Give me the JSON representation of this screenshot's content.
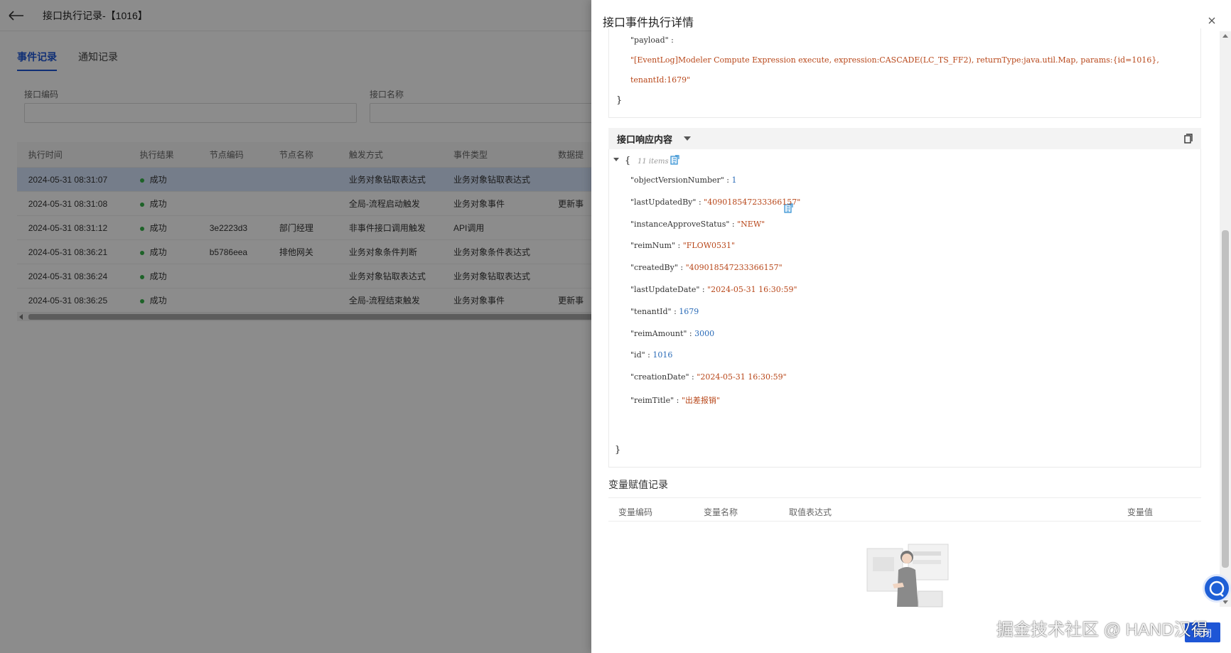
{
  "page": {
    "title": "接口执行记录-【1016】",
    "tabs": [
      {
        "label": "事件记录",
        "active": true
      },
      {
        "label": "通知记录",
        "active": false
      }
    ],
    "filters": {
      "code_label": "接口编码",
      "name_label": "接口名称"
    },
    "table": {
      "headers": [
        "执行时间",
        "执行结果",
        "节点编码",
        "节点名称",
        "触发方式",
        "事件类型",
        "数据提"
      ],
      "rows": [
        {
          "time": "2024-05-31 08:31:07",
          "result": "成功",
          "node_code": "",
          "node_name": "",
          "trigger": "业务对象钻取表达式",
          "event": "业务对象钻取表达式",
          "data": ""
        },
        {
          "time": "2024-05-31 08:31:08",
          "result": "成功",
          "node_code": "",
          "node_name": "",
          "trigger": "全局-流程启动触发",
          "event": "业务对象事件",
          "data": "更新事"
        },
        {
          "time": "2024-05-31 08:31:12",
          "result": "成功",
          "node_code": "3e2223d3",
          "node_name": "部门经理",
          "trigger": "非事件接口调用触发",
          "event": "API调用",
          "data": ""
        },
        {
          "time": "2024-05-31 08:36:21",
          "result": "成功",
          "node_code": "b5786eea",
          "node_name": "排他网关",
          "trigger": "业务对象条件判断",
          "event": "业务对象条件表达式",
          "data": ""
        },
        {
          "time": "2024-05-31 08:36:24",
          "result": "成功",
          "node_code": "",
          "node_name": "",
          "trigger": "业务对象钻取表达式",
          "event": "业务对象钻取表达式",
          "data": ""
        },
        {
          "time": "2024-05-31 08:36:25",
          "result": "成功",
          "node_code": "",
          "node_name": "",
          "trigger": "全局-流程结束触发",
          "event": "业务对象事件",
          "data": "更新事"
        }
      ]
    }
  },
  "drawer": {
    "title": "接口事件执行详情",
    "payload": {
      "key": "\"payload\" :",
      "line1": "\"[EventLog]Modeler Compute Expression execute, expression:CASCADE(LC_TS_FF2), returnType:java.util.Map, params:{id=1016},",
      "line2": "tenantId:1679\"",
      "close": "}"
    },
    "response": {
      "header": "接口响应内容",
      "open": "{",
      "count": "11 items",
      "close": "}",
      "fields": [
        {
          "key": "\"objectVersionNumber\"",
          "value": "1",
          "type": "number"
        },
        {
          "key": "\"lastUpdatedBy\"",
          "value": "\"409018547233366157\"",
          "type": "string"
        },
        {
          "key": "\"instanceApproveStatus\"",
          "value": "\"NEW\"",
          "type": "string"
        },
        {
          "key": "\"reimNum\"",
          "value": "\"FLOW0531\"",
          "type": "string"
        },
        {
          "key": "\"createdBy\"",
          "value": "\"409018547233366157\"",
          "type": "string"
        },
        {
          "key": "\"lastUpdateDate\"",
          "value": "\"2024-05-31 16:30:59\"",
          "type": "string"
        },
        {
          "key": "\"tenantId\"",
          "value": "1679",
          "type": "number"
        },
        {
          "key": "\"reimAmount\"",
          "value": "3000",
          "type": "number"
        },
        {
          "key": "\"id\"",
          "value": "1016",
          "type": "number"
        },
        {
          "key": "\"creationDate\"",
          "value": "\"2024-05-31 16:30:59\"",
          "type": "string"
        },
        {
          "key": "\"reimTitle\"",
          "value": "\"出差报销\"",
          "type": "string"
        }
      ]
    },
    "variables": {
      "title": "变量赋值记录",
      "headers": [
        "变量编码",
        "变量名称",
        "取值表达式",
        "变量值"
      ]
    },
    "confirm_label": "关闭"
  },
  "watermark": "掘金技术社区 @ HAND汉得",
  "colors": {
    "accent": "#1e56d6",
    "success": "#35b34a",
    "json_string": "#b8471a",
    "json_number": "#2a6bb8"
  }
}
